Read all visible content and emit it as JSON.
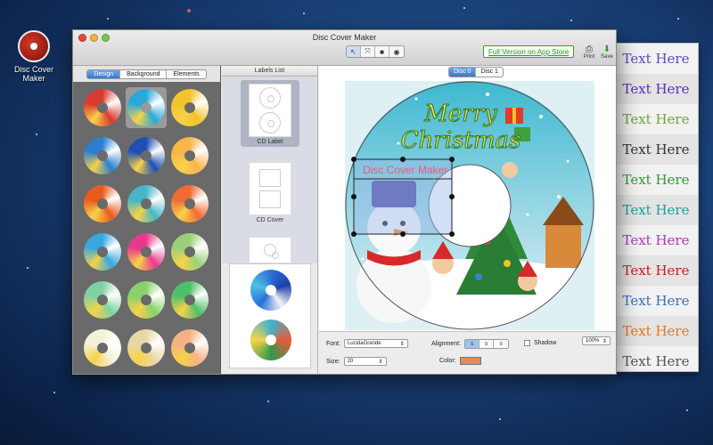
{
  "desktop_icon": {
    "label": "Disc Cover Maker"
  },
  "window": {
    "title": "Disc Cover Maker"
  },
  "toolbar": {
    "tools": [
      "↖",
      "⤧",
      "■",
      "◉"
    ],
    "full_version": "Full Version on App Store",
    "print_label": "Print",
    "save_label": "Save"
  },
  "left_panel": {
    "tabs": [
      "Design",
      "Background",
      "Elements"
    ],
    "active_tab": "Design",
    "disc_colors": [
      [
        "#d93a2e",
        "#2aa9d8",
        "#f2c32a"
      ],
      [
        "#2c7fd0",
        "#1f4fb3",
        "#f7b54a"
      ],
      [
        "#e95b1d",
        "#45b6c9",
        "#f06a36"
      ],
      [
        "#38a7e0",
        "#e63a8c",
        "#9bd07a"
      ],
      [
        "#7fd2a0",
        "#8ad16b",
        "#4fc06a"
      ],
      [
        "#f2f2d8",
        "#e8d8a8",
        "#f4b183"
      ],
      [
        "#e2c9a0",
        "#e0f4f8",
        "#a6d97c"
      ]
    ],
    "selected_index": 1
  },
  "labels_list": {
    "header": "Labels List",
    "items": [
      {
        "caption": "CD Label"
      },
      {
        "caption": "CD Cover"
      }
    ]
  },
  "canvas": {
    "disc_tabs": [
      "Disc 0",
      "Disc 1"
    ],
    "active_disc": "Disc 0",
    "greeting_line1": "Merry",
    "greeting_line2": "Christmas",
    "text_box_content": "Disc Cover Maker"
  },
  "format_bar": {
    "font_label": "Font:",
    "font_value": "LucidaGrande",
    "size_label": "Size:",
    "size_value": "20",
    "alignment_label": "Alignment:",
    "shadow_label": "Shadow",
    "color_label": "Color:",
    "color_value": "#e58a5a",
    "zoom": "100%"
  },
  "text_styles": [
    {
      "text": "Text Here",
      "color": "#5a4bb5"
    },
    {
      "text": "Text Here",
      "color": "#5a2fbf"
    },
    {
      "text": "Text Here",
      "color": "#6aa63a"
    },
    {
      "text": "Text Here",
      "color": "#333333"
    },
    {
      "text": "Text Here",
      "color": "#2ca02c"
    },
    {
      "text": "Text Here",
      "color": "#1aa0a0"
    },
    {
      "text": "Text Here",
      "color": "#b03ab0"
    },
    {
      "text": "Text Here",
      "color": "#c02020"
    },
    {
      "text": "Text Here",
      "color": "#3a6fb5"
    },
    {
      "text": "Text Here",
      "color": "#e07a20"
    },
    {
      "text": "Text Here",
      "color": "#555555"
    }
  ]
}
